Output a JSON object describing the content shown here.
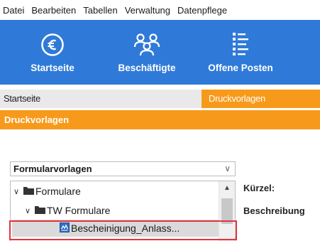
{
  "menubar": {
    "items": [
      "Datei",
      "Bearbeiten",
      "Tabellen",
      "Verwaltung",
      "Datenpflege"
    ]
  },
  "ribbon": {
    "buttons": [
      {
        "label": "Startseite",
        "icon": "euro-circle-icon"
      },
      {
        "label": "Beschäftigte",
        "icon": "employees-group-icon"
      },
      {
        "label": "Offene Posten",
        "icon": "open-items-list-icon"
      }
    ]
  },
  "tabs": {
    "startseite": "Startseite",
    "druckvorlagen": "Druckvorlagen"
  },
  "breadcrumb": "Druckvorlagen",
  "template_select": {
    "value": "Formularvorlagen"
  },
  "tree": {
    "nodes": [
      {
        "label": "Formulare",
        "icon": "folder-icon",
        "expanded": true
      },
      {
        "label": "TW Formulare",
        "icon": "folder-icon",
        "expanded": true
      },
      {
        "label": "Bescheinigung_Anlass...",
        "icon": "form-document-icon",
        "selected": true
      }
    ]
  },
  "details": {
    "kuerzel_label": "Kürzel:",
    "beschreibung_label": "Beschreibung"
  },
  "colors": {
    "ribbon": "#2f7ad8",
    "accent_orange": "#f79a1b",
    "highlight_red": "#e4333f"
  }
}
